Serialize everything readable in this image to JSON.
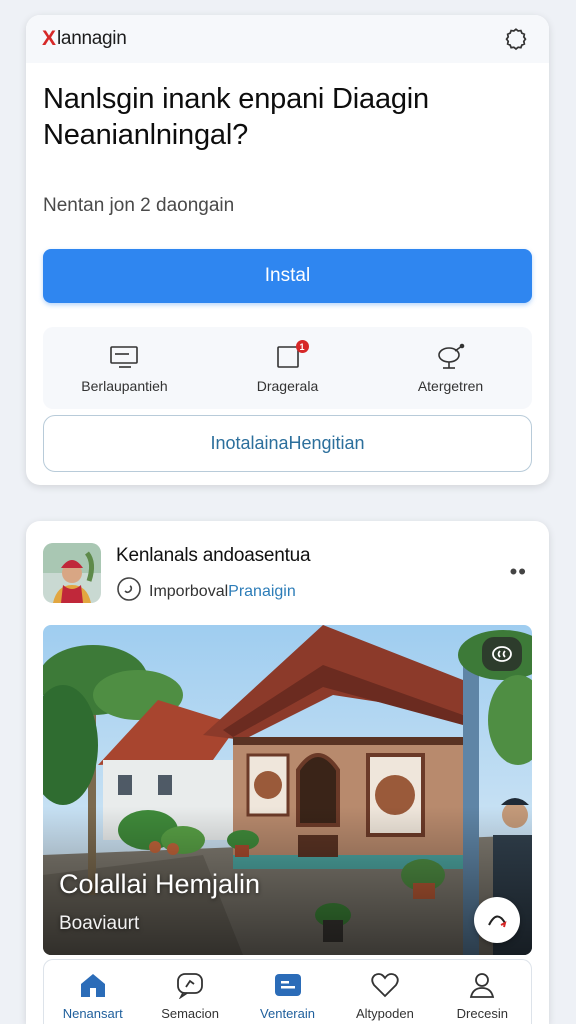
{
  "header": {
    "brand_mark": "X",
    "brand_name": "lannagin"
  },
  "prompt": {
    "headline": "Nanlsgin inank enpani Diaagin Neanianlningal?",
    "subtext": "Nentan jon 2 daongain",
    "install_label": "Instal"
  },
  "actions": [
    {
      "label": "Berlaupantieh",
      "icon": "monitor-icon"
    },
    {
      "label": "Dragerala",
      "icon": "notification-square-icon",
      "badge": "1"
    },
    {
      "label": "Atergetren",
      "icon": "satellite-dish-icon"
    }
  ],
  "secondary_button": {
    "label": "InotalainaHengitian"
  },
  "post": {
    "author": "Kenlanals andoasentua",
    "sub_prefix": "Imporboval",
    "sub_link": "Pranaigin",
    "more": "••",
    "photo_title": "Colallai Hemjalin",
    "photo_subtitle": "Boaviaurt"
  },
  "bottom_nav": [
    {
      "label": "Nenansart",
      "icon": "home-icon",
      "active": true
    },
    {
      "label": "Semacion",
      "icon": "chat-icon",
      "active": false
    },
    {
      "label": "Venterain",
      "icon": "media-icon",
      "active": true
    },
    {
      "label": "Altypoden",
      "icon": "heart-icon",
      "active": false
    },
    {
      "label": "Drecesin",
      "icon": "profile-icon",
      "active": false
    }
  ],
  "colors": {
    "accent": "#2f86f0",
    "brand_red": "#d62828",
    "link": "#2d7db8",
    "nav_active": "#2b6cb8"
  }
}
